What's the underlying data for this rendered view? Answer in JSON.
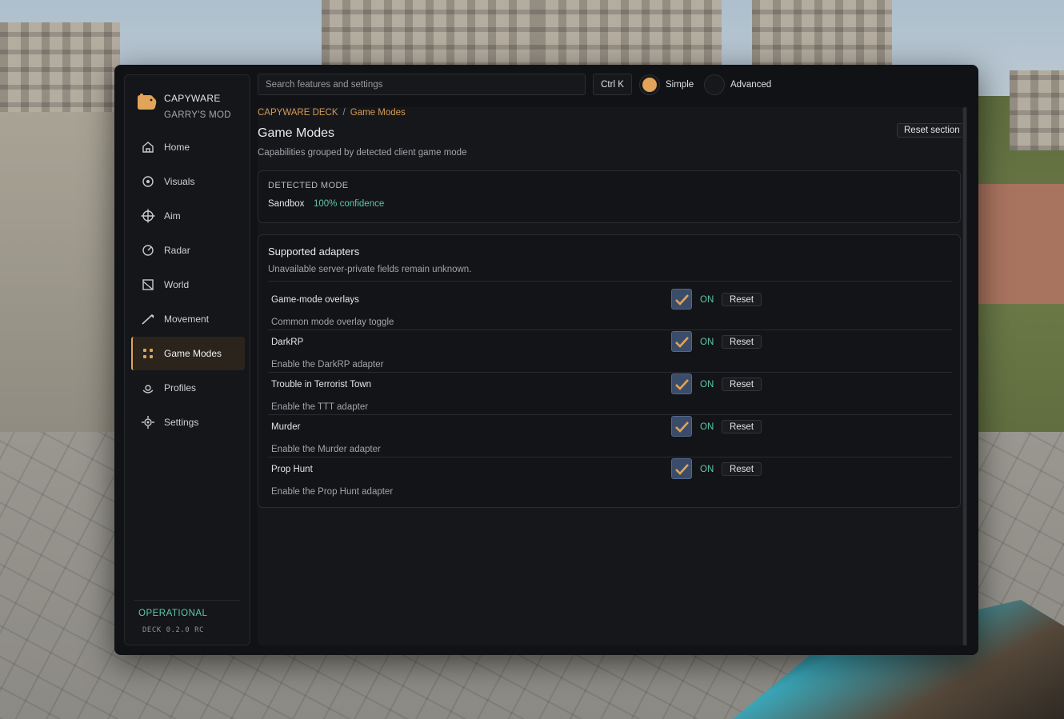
{
  "brand": {
    "name": "CAPYWARE",
    "subtitle": "GARRY'S MOD"
  },
  "colors": {
    "accent": "#e2a458",
    "ok": "#5cc9a4",
    "panel": "#111215"
  },
  "sidebar": {
    "items": [
      {
        "label": "Home",
        "icon": "home-icon"
      },
      {
        "label": "Visuals",
        "icon": "eye-icon"
      },
      {
        "label": "Aim",
        "icon": "crosshair-icon"
      },
      {
        "label": "Radar",
        "icon": "radar-icon"
      },
      {
        "label": "World",
        "icon": "world-icon"
      },
      {
        "label": "Movement",
        "icon": "movement-icon"
      },
      {
        "label": "Game Modes",
        "icon": "grid-icon",
        "active": true
      },
      {
        "label": "Profiles",
        "icon": "profile-icon"
      },
      {
        "label": "Settings",
        "icon": "gear-icon"
      }
    ],
    "status": "OPERATIONAL",
    "version": "DECK 0.2.0 RC"
  },
  "topbar": {
    "search_placeholder": "Search features and settings",
    "shortcut": "Ctrl K",
    "modes": [
      {
        "label": "Simple",
        "selected": true
      },
      {
        "label": "Advanced",
        "selected": false
      }
    ]
  },
  "breadcrumb": {
    "root": "CAPYWARE DECK",
    "sep": "/",
    "current": "Game Modes"
  },
  "page": {
    "title": "Game Modes",
    "subtitle": "Capabilities grouped by detected client game mode",
    "reset_section": "Reset section"
  },
  "detected": {
    "label": "DETECTED MODE",
    "mode": "Sandbox",
    "confidence": "100% confidence"
  },
  "adapters": {
    "title": "Supported adapters",
    "subtitle": "Unavailable server-private fields remain unknown.",
    "rows": [
      {
        "label": "Game-mode overlays",
        "desc": "Common mode overlay toggle",
        "state": "ON",
        "reset": "Reset",
        "checked": true
      },
      {
        "label": "DarkRP",
        "desc": "Enable the DarkRP adapter",
        "state": "ON",
        "reset": "Reset",
        "checked": true
      },
      {
        "label": "Trouble in Terrorist Town",
        "desc": "Enable the TTT adapter",
        "state": "ON",
        "reset": "Reset",
        "checked": true
      },
      {
        "label": "Murder",
        "desc": "Enable the Murder adapter",
        "state": "ON",
        "reset": "Reset",
        "checked": true
      },
      {
        "label": "Prop Hunt",
        "desc": "Enable the Prop Hunt adapter",
        "state": "ON",
        "reset": "Reset",
        "checked": true
      }
    ]
  }
}
